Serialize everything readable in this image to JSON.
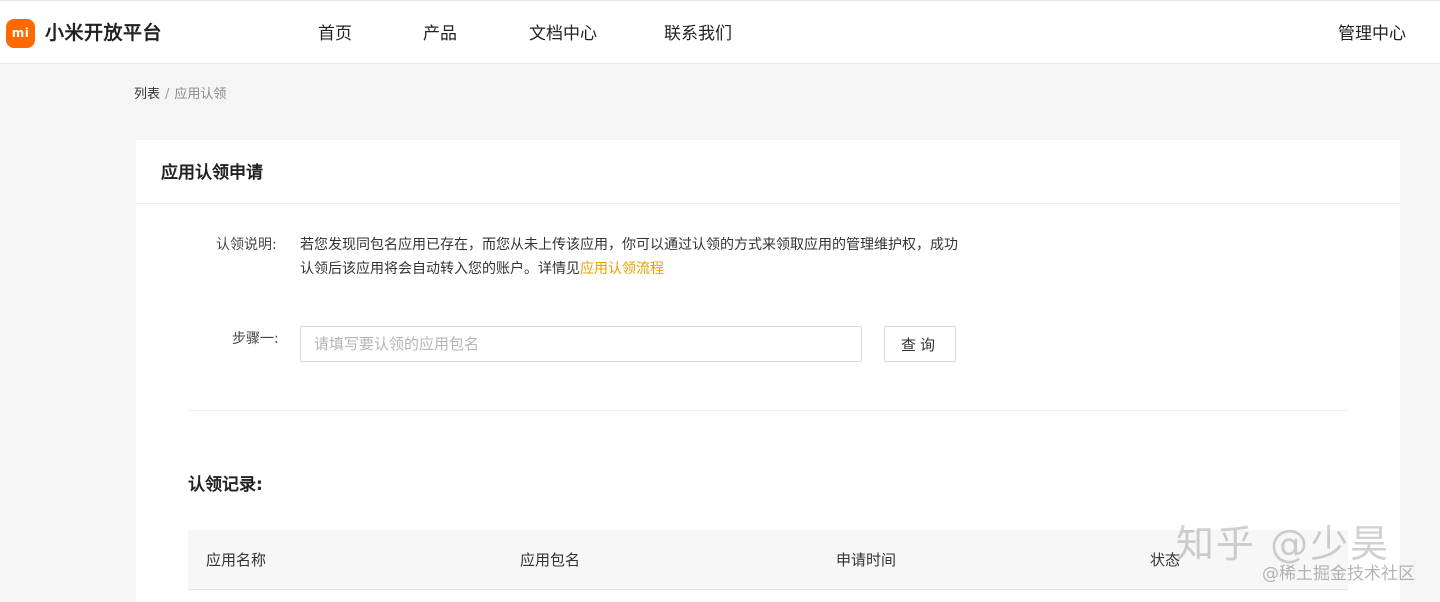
{
  "header": {
    "logo_text": "mi",
    "brand": "小米开放平台",
    "nav": {
      "home": "首页",
      "products": "产品",
      "docs": "文档中心",
      "contact": "联系我们"
    },
    "admin": "管理中心"
  },
  "breadcrumb": {
    "list": "列表",
    "separator": "/",
    "current": "应用认领"
  },
  "card": {
    "title": "应用认领申请",
    "description": {
      "label": "认领说明:",
      "text": "若您发现同包名应用已存在，而您从未上传该应用，你可以通过认领的方式来领取应用的管理维护权，成功认领后该应用将会自动转入您的账户。详情见",
      "link": "应用认领流程"
    },
    "step1": {
      "label": "步骤一:",
      "input_value": "",
      "input_placeholder": "请填写要认领的应用包名",
      "query_button": "查询"
    },
    "records": {
      "title": "认领记录:",
      "columns": [
        "应用名称",
        "应用包名",
        "申请时间",
        "状态"
      ]
    }
  },
  "watermark": {
    "main": "知乎 @少昊",
    "sub": "@稀土掘金技术社区"
  },
  "colors": {
    "brand_orange": "#ff6900",
    "link": "#e8a000"
  }
}
